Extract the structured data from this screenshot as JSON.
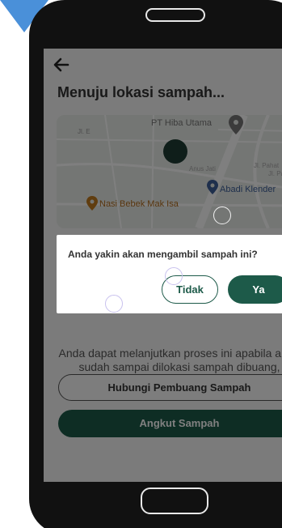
{
  "screen": {
    "title": "Menuju lokasi sampah...",
    "info_text": "Anda dapat melanjutkan proses ini apabila anda sudah sampai dilokasi sampah dibuang, silahkan menuju lokasi sampah",
    "contact_button": "Hubungi Pembuang Sampah",
    "pickup_button": "Angkut Sampah"
  },
  "map": {
    "labels": {
      "pt_hiba": "PT Hiba Utama",
      "abadi": "Abadi Klender",
      "nasi_bebek": "Nasi Bebek Mak Isa",
      "jl_e": "Jl. E",
      "anus_jati": "Anus Jati",
      "jl_pahat": "Jl. Pahat",
      "jl_pa": "Jl. Pa"
    }
  },
  "dialog": {
    "message": "Anda yakin akan mengambil sampah ini?",
    "no_label": "Tidak",
    "yes_label": "Ya"
  },
  "colors": {
    "primary": "#1d5a49",
    "corner_accent": "#4a90d9"
  }
}
